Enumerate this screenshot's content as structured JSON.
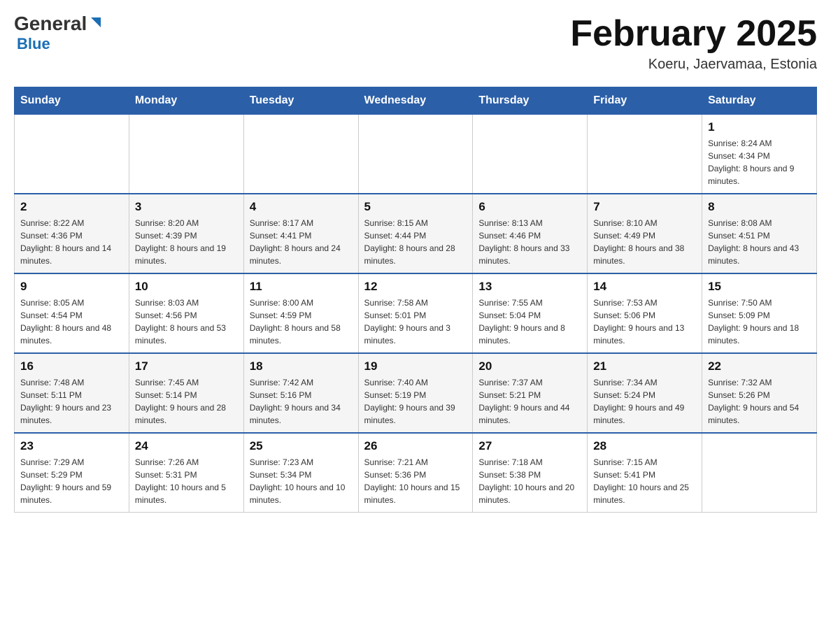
{
  "header": {
    "logo_general": "General",
    "logo_blue": "Blue",
    "title": "February 2025",
    "location": "Koeru, Jaervamaa, Estonia"
  },
  "days_of_week": [
    "Sunday",
    "Monday",
    "Tuesday",
    "Wednesday",
    "Thursday",
    "Friday",
    "Saturday"
  ],
  "weeks": [
    [
      {
        "day": "",
        "sunrise": "",
        "sunset": "",
        "daylight": ""
      },
      {
        "day": "",
        "sunrise": "",
        "sunset": "",
        "daylight": ""
      },
      {
        "day": "",
        "sunrise": "",
        "sunset": "",
        "daylight": ""
      },
      {
        "day": "",
        "sunrise": "",
        "sunset": "",
        "daylight": ""
      },
      {
        "day": "",
        "sunrise": "",
        "sunset": "",
        "daylight": ""
      },
      {
        "day": "",
        "sunrise": "",
        "sunset": "",
        "daylight": ""
      },
      {
        "day": "1",
        "sunrise": "Sunrise: 8:24 AM",
        "sunset": "Sunset: 4:34 PM",
        "daylight": "Daylight: 8 hours and 9 minutes."
      }
    ],
    [
      {
        "day": "2",
        "sunrise": "Sunrise: 8:22 AM",
        "sunset": "Sunset: 4:36 PM",
        "daylight": "Daylight: 8 hours and 14 minutes."
      },
      {
        "day": "3",
        "sunrise": "Sunrise: 8:20 AM",
        "sunset": "Sunset: 4:39 PM",
        "daylight": "Daylight: 8 hours and 19 minutes."
      },
      {
        "day": "4",
        "sunrise": "Sunrise: 8:17 AM",
        "sunset": "Sunset: 4:41 PM",
        "daylight": "Daylight: 8 hours and 24 minutes."
      },
      {
        "day": "5",
        "sunrise": "Sunrise: 8:15 AM",
        "sunset": "Sunset: 4:44 PM",
        "daylight": "Daylight: 8 hours and 28 minutes."
      },
      {
        "day": "6",
        "sunrise": "Sunrise: 8:13 AM",
        "sunset": "Sunset: 4:46 PM",
        "daylight": "Daylight: 8 hours and 33 minutes."
      },
      {
        "day": "7",
        "sunrise": "Sunrise: 8:10 AM",
        "sunset": "Sunset: 4:49 PM",
        "daylight": "Daylight: 8 hours and 38 minutes."
      },
      {
        "day": "8",
        "sunrise": "Sunrise: 8:08 AM",
        "sunset": "Sunset: 4:51 PM",
        "daylight": "Daylight: 8 hours and 43 minutes."
      }
    ],
    [
      {
        "day": "9",
        "sunrise": "Sunrise: 8:05 AM",
        "sunset": "Sunset: 4:54 PM",
        "daylight": "Daylight: 8 hours and 48 minutes."
      },
      {
        "day": "10",
        "sunrise": "Sunrise: 8:03 AM",
        "sunset": "Sunset: 4:56 PM",
        "daylight": "Daylight: 8 hours and 53 minutes."
      },
      {
        "day": "11",
        "sunrise": "Sunrise: 8:00 AM",
        "sunset": "Sunset: 4:59 PM",
        "daylight": "Daylight: 8 hours and 58 minutes."
      },
      {
        "day": "12",
        "sunrise": "Sunrise: 7:58 AM",
        "sunset": "Sunset: 5:01 PM",
        "daylight": "Daylight: 9 hours and 3 minutes."
      },
      {
        "day": "13",
        "sunrise": "Sunrise: 7:55 AM",
        "sunset": "Sunset: 5:04 PM",
        "daylight": "Daylight: 9 hours and 8 minutes."
      },
      {
        "day": "14",
        "sunrise": "Sunrise: 7:53 AM",
        "sunset": "Sunset: 5:06 PM",
        "daylight": "Daylight: 9 hours and 13 minutes."
      },
      {
        "day": "15",
        "sunrise": "Sunrise: 7:50 AM",
        "sunset": "Sunset: 5:09 PM",
        "daylight": "Daylight: 9 hours and 18 minutes."
      }
    ],
    [
      {
        "day": "16",
        "sunrise": "Sunrise: 7:48 AM",
        "sunset": "Sunset: 5:11 PM",
        "daylight": "Daylight: 9 hours and 23 minutes."
      },
      {
        "day": "17",
        "sunrise": "Sunrise: 7:45 AM",
        "sunset": "Sunset: 5:14 PM",
        "daylight": "Daylight: 9 hours and 28 minutes."
      },
      {
        "day": "18",
        "sunrise": "Sunrise: 7:42 AM",
        "sunset": "Sunset: 5:16 PM",
        "daylight": "Daylight: 9 hours and 34 minutes."
      },
      {
        "day": "19",
        "sunrise": "Sunrise: 7:40 AM",
        "sunset": "Sunset: 5:19 PM",
        "daylight": "Daylight: 9 hours and 39 minutes."
      },
      {
        "day": "20",
        "sunrise": "Sunrise: 7:37 AM",
        "sunset": "Sunset: 5:21 PM",
        "daylight": "Daylight: 9 hours and 44 minutes."
      },
      {
        "day": "21",
        "sunrise": "Sunrise: 7:34 AM",
        "sunset": "Sunset: 5:24 PM",
        "daylight": "Daylight: 9 hours and 49 minutes."
      },
      {
        "day": "22",
        "sunrise": "Sunrise: 7:32 AM",
        "sunset": "Sunset: 5:26 PM",
        "daylight": "Daylight: 9 hours and 54 minutes."
      }
    ],
    [
      {
        "day": "23",
        "sunrise": "Sunrise: 7:29 AM",
        "sunset": "Sunset: 5:29 PM",
        "daylight": "Daylight: 9 hours and 59 minutes."
      },
      {
        "day": "24",
        "sunrise": "Sunrise: 7:26 AM",
        "sunset": "Sunset: 5:31 PM",
        "daylight": "Daylight: 10 hours and 5 minutes."
      },
      {
        "day": "25",
        "sunrise": "Sunrise: 7:23 AM",
        "sunset": "Sunset: 5:34 PM",
        "daylight": "Daylight: 10 hours and 10 minutes."
      },
      {
        "day": "26",
        "sunrise": "Sunrise: 7:21 AM",
        "sunset": "Sunset: 5:36 PM",
        "daylight": "Daylight: 10 hours and 15 minutes."
      },
      {
        "day": "27",
        "sunrise": "Sunrise: 7:18 AM",
        "sunset": "Sunset: 5:38 PM",
        "daylight": "Daylight: 10 hours and 20 minutes."
      },
      {
        "day": "28",
        "sunrise": "Sunrise: 7:15 AM",
        "sunset": "Sunset: 5:41 PM",
        "daylight": "Daylight: 10 hours and 25 minutes."
      },
      {
        "day": "",
        "sunrise": "",
        "sunset": "",
        "daylight": ""
      }
    ]
  ]
}
